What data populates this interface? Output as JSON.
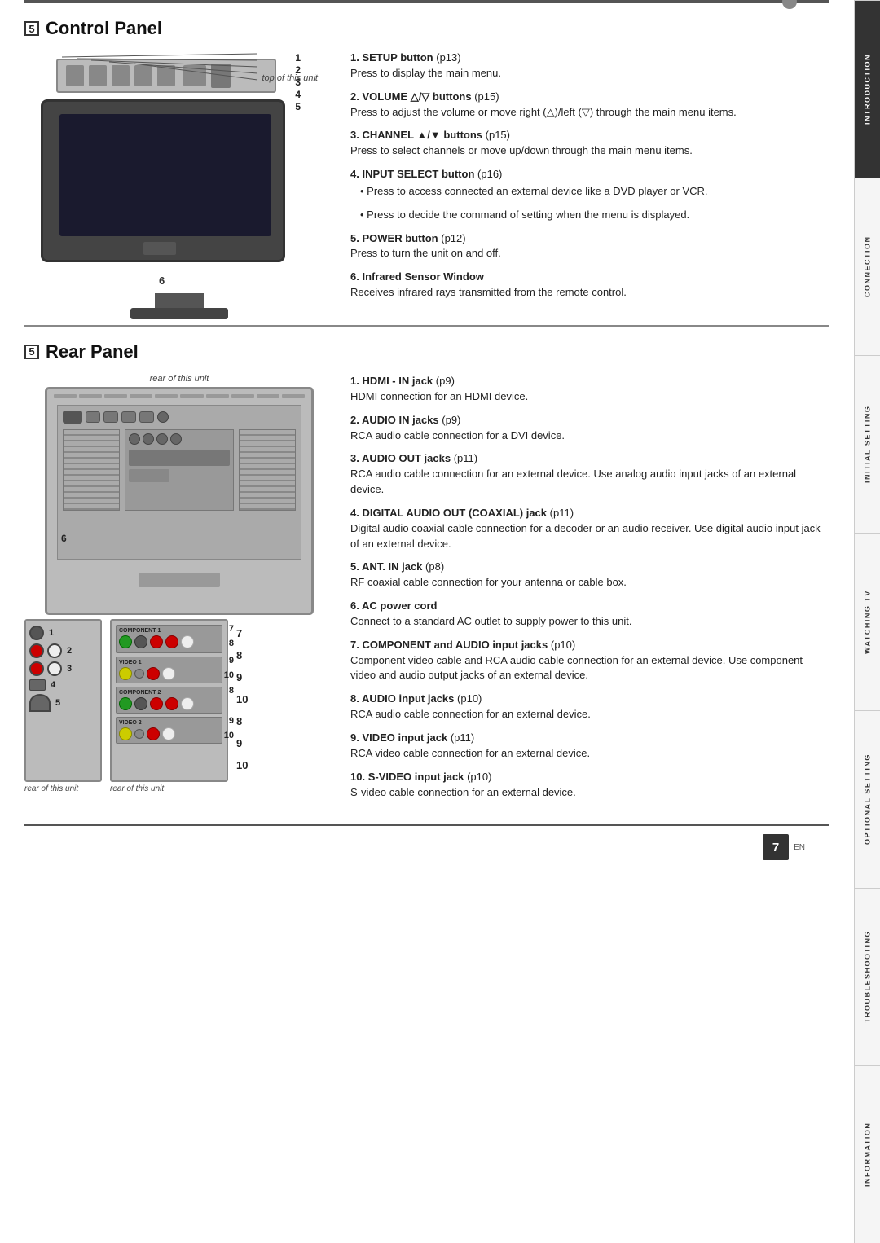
{
  "sidebar": {
    "tabs": [
      {
        "label": "INTRODUCTION",
        "active": true
      },
      {
        "label": "CONNECTION",
        "active": false
      },
      {
        "label": "INITIAL SETTING",
        "active": false
      },
      {
        "label": "WATCHING TV",
        "active": false
      },
      {
        "label": "OPTIONAL SETTING",
        "active": false
      },
      {
        "label": "TROUBLESHOOTING",
        "active": false
      },
      {
        "label": "INFORMATION",
        "active": false
      }
    ]
  },
  "control_panel": {
    "section_title": "Control Panel",
    "caption_top": "top of this unit",
    "items": [
      {
        "num": "1",
        "title": "SETUP button",
        "ref": "p13",
        "desc": "Press to display the main menu.",
        "sub": []
      },
      {
        "num": "2",
        "title": "VOLUME △/▽ buttons",
        "ref": "p15",
        "desc": "Press to adjust the volume or move right (△)/left (▽) through the main menu items.",
        "sub": []
      },
      {
        "num": "3",
        "title": "CHANNEL ▲/▼ buttons",
        "ref": "p15",
        "desc": "Press to select channels or move up/down through the main menu items.",
        "sub": []
      },
      {
        "num": "4",
        "title": "INPUT SELECT button",
        "ref": "p16",
        "desc": "",
        "sub": [
          "Press to access connected an external device like a DVD player or VCR.",
          "Press to decide the command of setting when the menu is displayed."
        ]
      },
      {
        "num": "5",
        "title": "POWER button",
        "ref": "p12",
        "desc": "Press to turn the unit on and off.",
        "sub": []
      },
      {
        "num": "6",
        "title": "Infrared Sensor Window",
        "ref": "",
        "desc": "Receives infrared rays transmitted from the remote control.",
        "sub": []
      }
    ]
  },
  "rear_panel": {
    "section_title": "Rear Panel",
    "caption_rear": "rear of this unit",
    "caption_rear2": "rear of this unit",
    "items": [
      {
        "num": "1",
        "title": "HDMI - IN jack",
        "ref": "p9",
        "desc": "HDMI connection for an HDMI device.",
        "sub": []
      },
      {
        "num": "2",
        "title": "AUDIO IN jacks",
        "ref": "p9",
        "desc": "RCA audio cable connection for a DVI device.",
        "sub": []
      },
      {
        "num": "3",
        "title": "AUDIO OUT jacks",
        "ref": "p11",
        "desc": "RCA audio cable connection for an external device. Use analog audio input jacks of an external device.",
        "sub": []
      },
      {
        "num": "4",
        "title": "DIGITAL AUDIO OUT (COAXIAL) jack",
        "ref": "p11",
        "desc": "Digital audio coaxial cable connection for a decoder or an audio receiver. Use digital audio input jack of an external device.",
        "sub": []
      },
      {
        "num": "5",
        "title": "ANT. IN jack",
        "ref": "p8",
        "desc": "RF coaxial cable connection for your antenna or cable box.",
        "sub": []
      },
      {
        "num": "6",
        "title": "AC power cord",
        "ref": "",
        "desc": "Connect to a standard AC outlet to supply power to this unit.",
        "sub": []
      },
      {
        "num": "7",
        "title": "COMPONENT and AUDIO input jacks",
        "ref": "p10",
        "desc": "Component video cable and RCA audio cable connection for an external device. Use component video and audio output jacks of an external device.",
        "sub": []
      },
      {
        "num": "8",
        "title": "AUDIO input jacks",
        "ref": "p10",
        "desc": "RCA audio cable connection for an external device.",
        "sub": []
      },
      {
        "num": "9",
        "title": "VIDEO input jack",
        "ref": "p11",
        "desc": "RCA video cable connection for an external device.",
        "sub": []
      },
      {
        "num": "10",
        "title": "S-VIDEO input jack",
        "ref": "p10",
        "desc": "S-video cable connection for an external device.",
        "sub": []
      }
    ]
  },
  "page": {
    "number": "7",
    "lang": "EN"
  }
}
